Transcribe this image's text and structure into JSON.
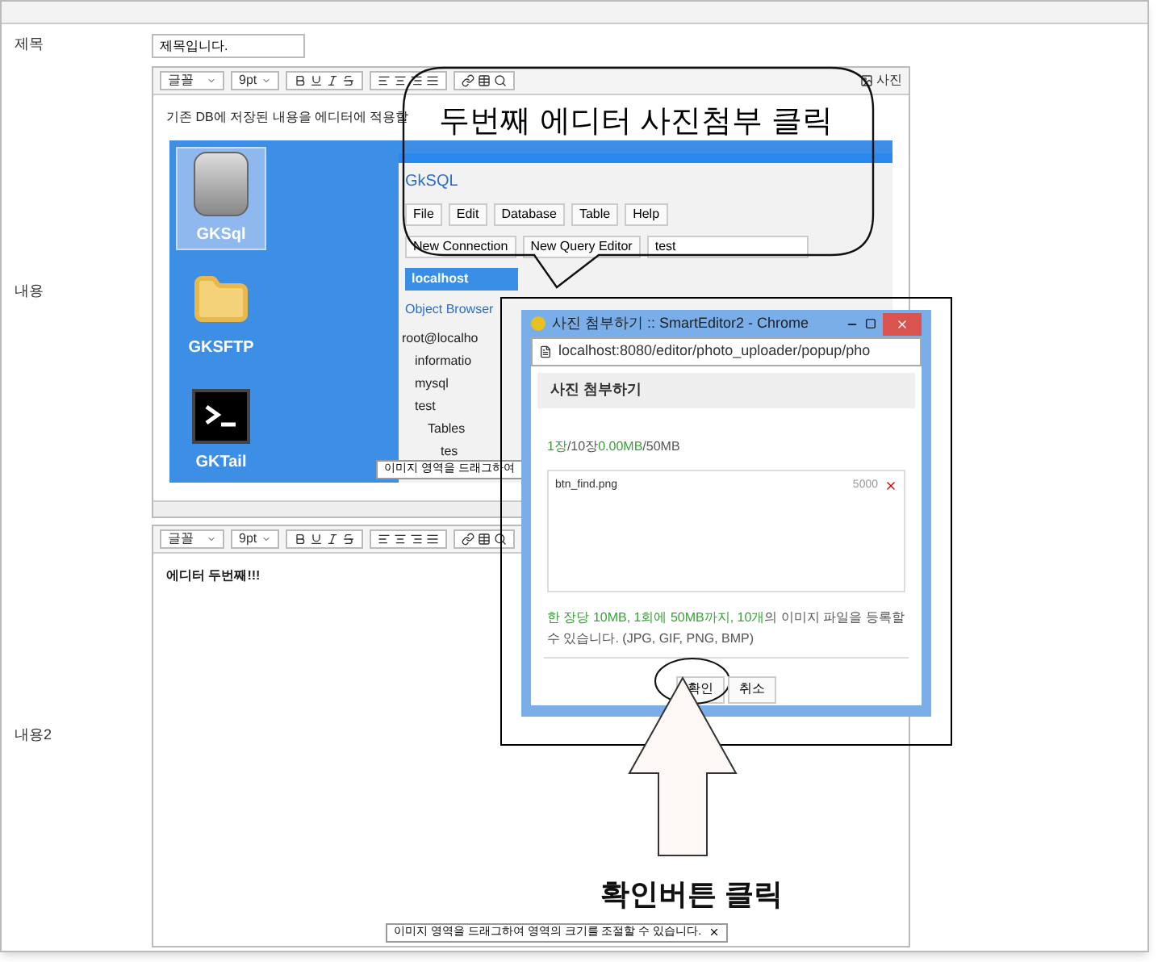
{
  "form": {
    "title_label": "제목",
    "title_value": "제목입니다.",
    "content_label": "내용",
    "content2_label": "내용2"
  },
  "editors": [
    {
      "toolbar": {
        "font": "글꼴",
        "size": "9pt",
        "photo_button": "사진"
      },
      "text": "기존 DB에 저장된 내용을 에디터에 적용할",
      "has_image": true,
      "tooltip": "이미지 영역을 드래그하여"
    },
    {
      "toolbar": {
        "font": "글꼴",
        "size": "9pt"
      },
      "text": "에디터 두번째!!!",
      "has_image": false,
      "tooltip": "이미지 영역을 드래그하여 영역의 크기를 조절할 수 있습니다."
    }
  ],
  "desktop": {
    "icons": [
      {
        "label": "GKSql",
        "kind": "database",
        "selected": true
      },
      {
        "label": "GKSFTP",
        "kind": "folder",
        "selected": false
      },
      {
        "label": "GKTail",
        "kind": "terminal",
        "selected": false
      }
    ],
    "app": {
      "title": "GkSQL",
      "menus": [
        "File",
        "Edit",
        "Database",
        "Table",
        "Help"
      ],
      "buttons": [
        "New Connection",
        "New Query Editor"
      ],
      "database": "test",
      "tab": "localhost",
      "panel": "Object Browser",
      "tree": [
        {
          "label": "root@localho",
          "children": [
            {
              "label": "informatio"
            },
            {
              "label": "mysql"
            },
            {
              "label": "test",
              "children": [
                {
                  "label": "Tables",
                  "children": [
                    {
                      "label": "tes"
                    }
                  ]
                }
              ]
            }
          ]
        }
      ]
    }
  },
  "popup": {
    "title": "사진 첨부하기 :: SmartEditor2 - Chrome",
    "url": "localhost:8080/editor/photo_uploader/popup/pho",
    "header": "사진 첨부하기",
    "counter": [
      {
        "text": "1장",
        "highlight": true
      },
      {
        "text": "/10장",
        "highlight": false
      },
      {
        "text": "0.00MB",
        "highlight": true
      },
      {
        "text": "/50MB",
        "highlight": false
      }
    ],
    "files": [
      {
        "name": "btn_find.png",
        "size": "5000"
      }
    ],
    "notice": [
      {
        "text": "한 장당 10MB, 1회에 50MB까지, 10개",
        "highlight": true
      },
      {
        "text": "의 이미지 파일을 등록할 수 있습니다. (JPG, GIF, PNG, BMP)",
        "highlight": false
      }
    ],
    "buttons": [
      {
        "label": "확인",
        "circled": true
      },
      {
        "label": "취소",
        "circled": false
      }
    ]
  },
  "annotations": {
    "callout": "두번째 에디터 사진첨부 클릭",
    "caption": "확인버튼 클릭"
  }
}
